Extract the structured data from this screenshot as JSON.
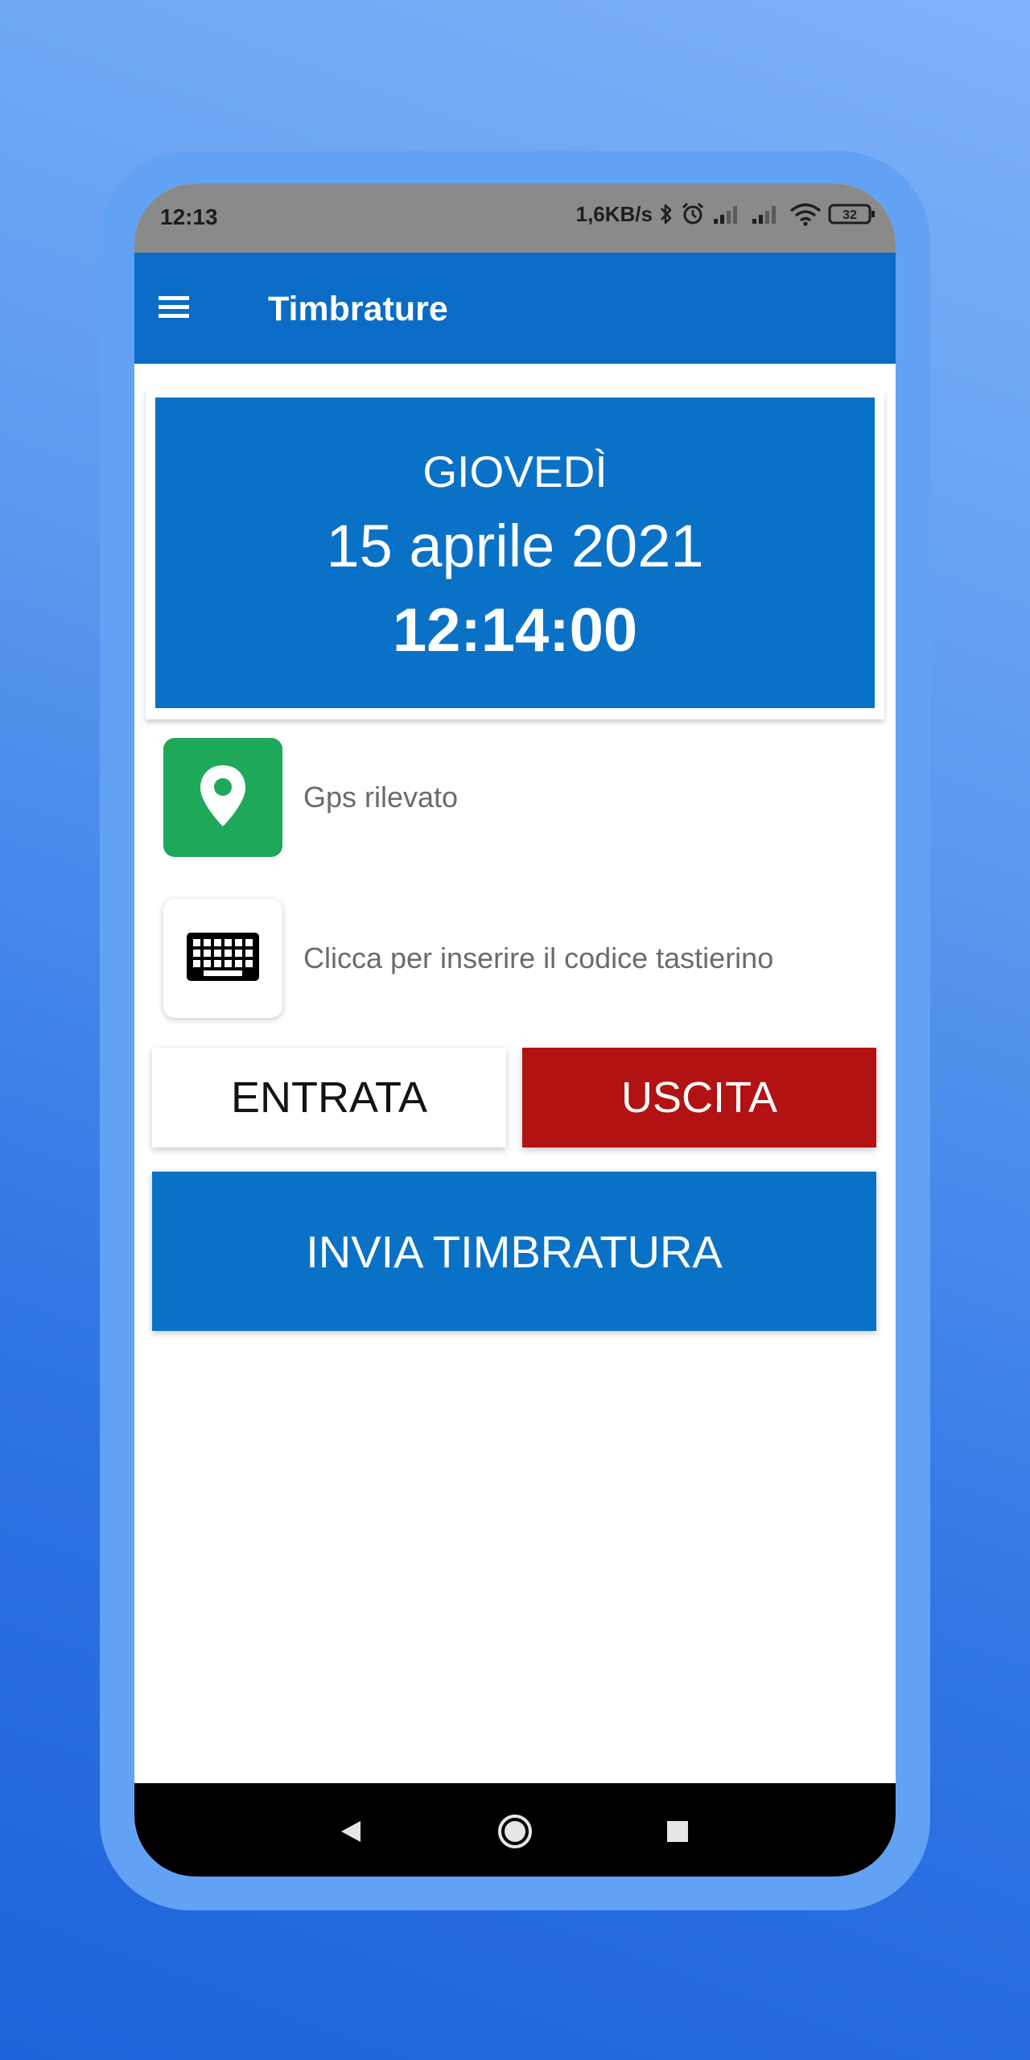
{
  "status_bar": {
    "time": "12:13",
    "network_speed": "1,6KB/s",
    "battery_level": "32",
    "icons": [
      "bluetooth-icon",
      "alarm-icon",
      "signal-icon",
      "signal-icon",
      "wifi-icon",
      "battery-icon"
    ]
  },
  "app_bar": {
    "title": "Timbrature",
    "menu_icon": "menu-icon"
  },
  "date_card": {
    "day_name": "GIOVEDÌ",
    "date": "15 aprile 2021",
    "time": "12:14:00"
  },
  "gps": {
    "icon": "location-pin-icon",
    "label": "Gps rilevato"
  },
  "keypad": {
    "icon": "keyboard-icon",
    "label": "Clicca per inserire il codice tastierino"
  },
  "buttons": {
    "entrata": "ENTRATA",
    "uscita": "USCITA",
    "invia": "INVIA TIMBRATURA"
  },
  "nav_bar": {
    "icons": [
      "back-icon",
      "home-icon",
      "recent-apps-icon"
    ]
  },
  "colors": {
    "primary": "#0a72c6",
    "app_bar": "#0a6cc6",
    "danger": "#b31212",
    "gps_green": "#1ea85a",
    "status_bar": "#8a8a8a"
  }
}
